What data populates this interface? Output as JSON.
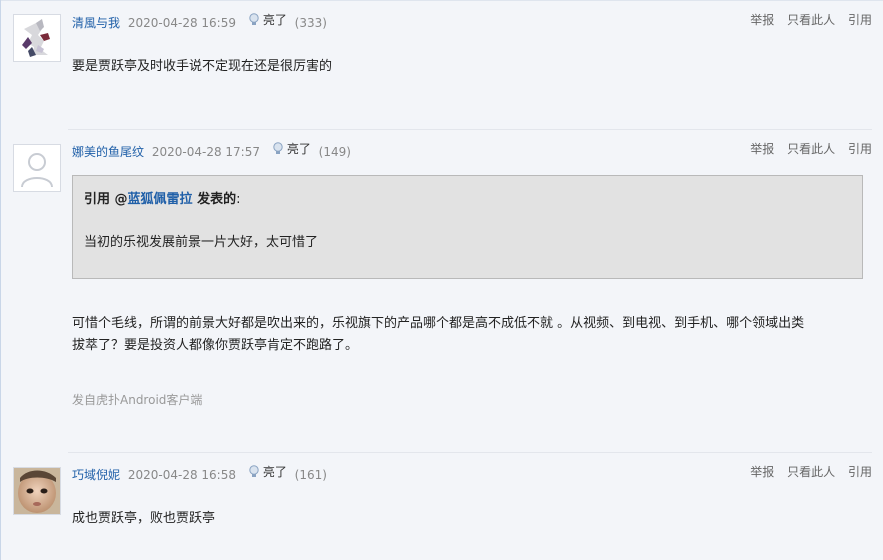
{
  "actions": {
    "report": "举报",
    "only_this": "只看此人",
    "quote": "引用"
  },
  "posts": [
    {
      "user": "清風与我",
      "time": "2020-04-28 16:59",
      "light_label": "亮了",
      "light_count": "(333)",
      "content": "要是贾跃亭及时收手说不定现在还是很厉害的",
      "avatar": "character-avatar"
    },
    {
      "user": "娜美的鱼尾纹",
      "time": "2020-04-28 17:57",
      "light_label": "亮了",
      "light_count": "(149)",
      "quote": {
        "prefix": "引用 @",
        "user": "蓝狐佩雷拉",
        "suffix": " 发表的",
        "colon": ":",
        "text": "当初的乐视发展前景一片大好，太可惜了"
      },
      "content_line1": "可惜个毛线，所谓的前景大好都是吹出来的，乐视旗下的产品哪个都是高不成低不就 。从视频、到电视、到手机、哪个领域出类",
      "content_line2": "拔萃了？要是投资人都像你贾跃亭肯定不跑路了。",
      "source": "发自虎扑Android客户端",
      "avatar": "default-user-avatar"
    },
    {
      "user": "巧域倪妮",
      "time": "2020-04-28 16:58",
      "light_label": "亮了",
      "light_count": "(161)",
      "content": "成也贾跃亭，败也贾跃亭",
      "avatar": "baby-photo-avatar"
    }
  ],
  "colors": {
    "link": "#1f5fa8",
    "meta": "#888888",
    "quote_bg": "#e2e2e2",
    "page_bg": "#f3f5f9"
  },
  "icons": {
    "light": "lightbulb-icon"
  }
}
